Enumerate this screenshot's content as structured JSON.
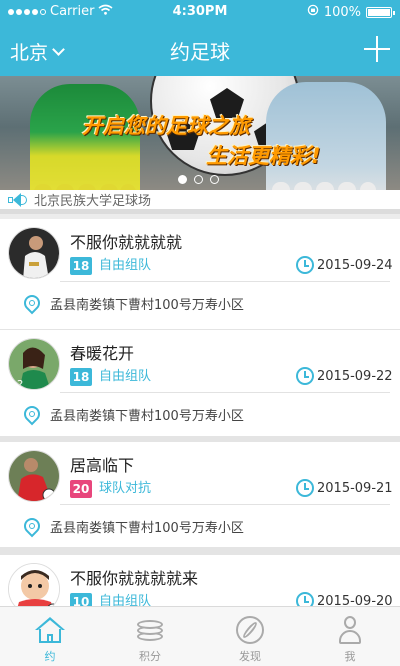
{
  "status_bar": {
    "carrier": "Carrier",
    "time": "4:30PM",
    "battery": "100%"
  },
  "nav": {
    "city": "北京",
    "title": "约足球"
  },
  "banner": {
    "line1": "开启您的足球之旅",
    "line2": "生活更精彩!",
    "pages": 3,
    "active_page": 0
  },
  "notice": {
    "text": "北京民族大学足球场"
  },
  "matches": [
    {
      "name": "不服你就就就就",
      "players": "18",
      "badge_color": "#3cb8d9",
      "type": "自由组队",
      "date": "2015-09-24",
      "address": "孟县南娄镇下曹村100号万寿小区",
      "avatar": "player-avatar"
    },
    {
      "name": "春暖花开",
      "players": "18",
      "badge_color": "#3cb8d9",
      "type": "自由组队",
      "date": "2015-09-22",
      "address": "孟县南娄镇下曹村100号万寿小区",
      "avatar": "player-avatar"
    },
    {
      "name": "居高临下",
      "players": "20",
      "badge_color": "#e8467c",
      "type": "球队对抗",
      "date": "2015-09-21",
      "address": "孟县南娄镇下曹村100号万寿小区",
      "avatar": "player-avatar"
    },
    {
      "name": "不服你就就就就来",
      "players": "10",
      "badge_color": "#3cb8d9",
      "type": "自由组队",
      "date": "2015-09-20",
      "address": "",
      "avatar": "cartoon-avatar"
    }
  ],
  "tabs": [
    {
      "label": "约",
      "icon": "home-icon",
      "active": true
    },
    {
      "label": "积分",
      "icon": "database-icon",
      "active": false
    },
    {
      "label": "发现",
      "icon": "compass-icon",
      "active": false
    },
    {
      "label": "我",
      "icon": "person-icon",
      "active": false
    }
  ],
  "colors": {
    "accent": "#3cb8d9",
    "versus_badge": "#e8467c"
  }
}
